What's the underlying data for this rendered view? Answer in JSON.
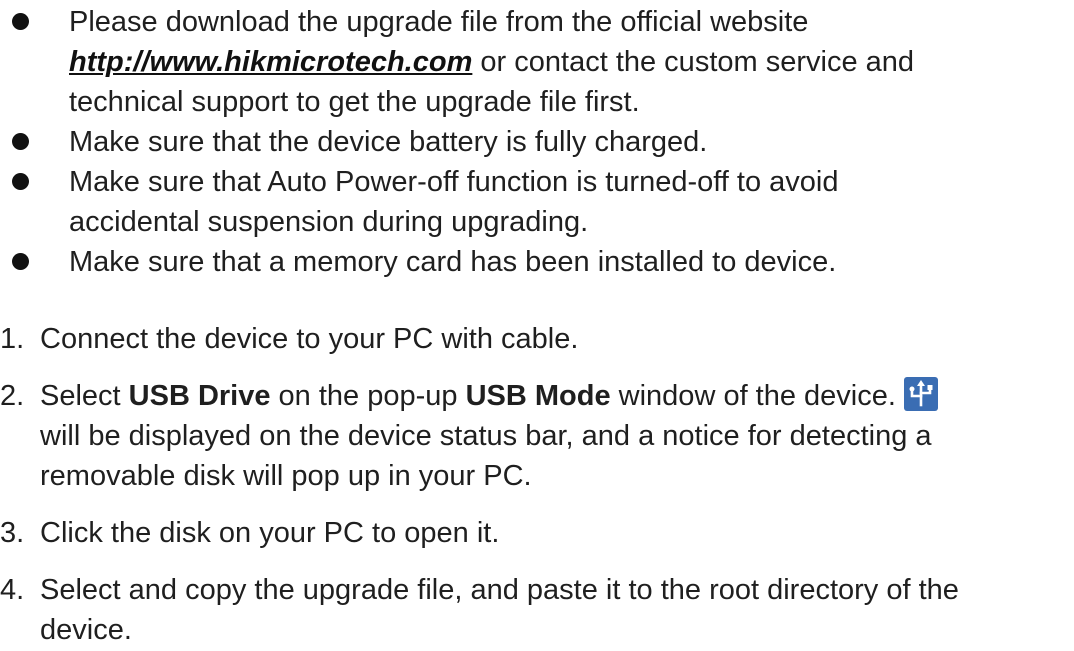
{
  "bullets": [
    {
      "line1": "Please download the upgrade file from the official website",
      "link": "http://www.hikmicrotech.com",
      "line2_rest": " or contact the custom service and",
      "line3": "technical support to get the upgrade file first."
    },
    {
      "text": "Make sure that the device battery is fully charged."
    },
    {
      "line1": "Make sure that Auto Power-off function is turned-off to avoid",
      "line2": "accidental suspension during upgrading."
    },
    {
      "text": "Make sure that a memory card has been installed to device."
    }
  ],
  "steps": [
    {
      "num": "1.",
      "text": "Connect the device to your PC with cable."
    },
    {
      "num": "2.",
      "t1": "Select ",
      "b1": "USB Drive",
      "t2": " on the pop-up ",
      "b2": "USB Mode",
      "t3": " window of the device.",
      "icon": "usb-drive-icon",
      "line2": "will be displayed on the device status bar, and a notice for detecting a",
      "line3": "removable disk will pop up in your PC."
    },
    {
      "num": "3.",
      "text": "Click the disk on your PC to open it."
    },
    {
      "num": "4.",
      "line1": "Select and copy the upgrade file, and paste it to the root directory of the",
      "line2": "device."
    }
  ],
  "colors": {
    "text": "#1f1f1f",
    "icon_bg": "#3a6db3",
    "icon_fg": "#ffffff"
  }
}
